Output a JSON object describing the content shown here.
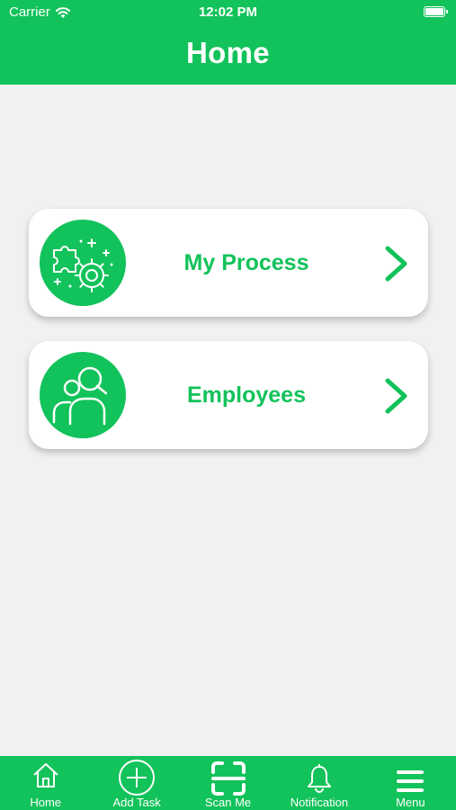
{
  "status_bar": {
    "carrier": "Carrier",
    "time": "12:02 PM"
  },
  "header": {
    "title": "Home"
  },
  "menu_cards": [
    {
      "label": "My Process",
      "icon": "puzzle-gear-icon"
    },
    {
      "label": "Employees",
      "icon": "people-search-icon"
    }
  ],
  "tab_bar": [
    {
      "label": "Home",
      "icon": "home-icon"
    },
    {
      "label": "Add Task",
      "icon": "plus-circle-icon"
    },
    {
      "label": "Scan Me",
      "icon": "scan-frame-icon"
    },
    {
      "label": "Notification",
      "icon": "bell-icon"
    },
    {
      "label": "Menu",
      "icon": "hamburger-menu-icon"
    }
  ],
  "colors": {
    "accent": "#12c25a",
    "background": "#f1f1f1",
    "card": "#ffffff"
  }
}
